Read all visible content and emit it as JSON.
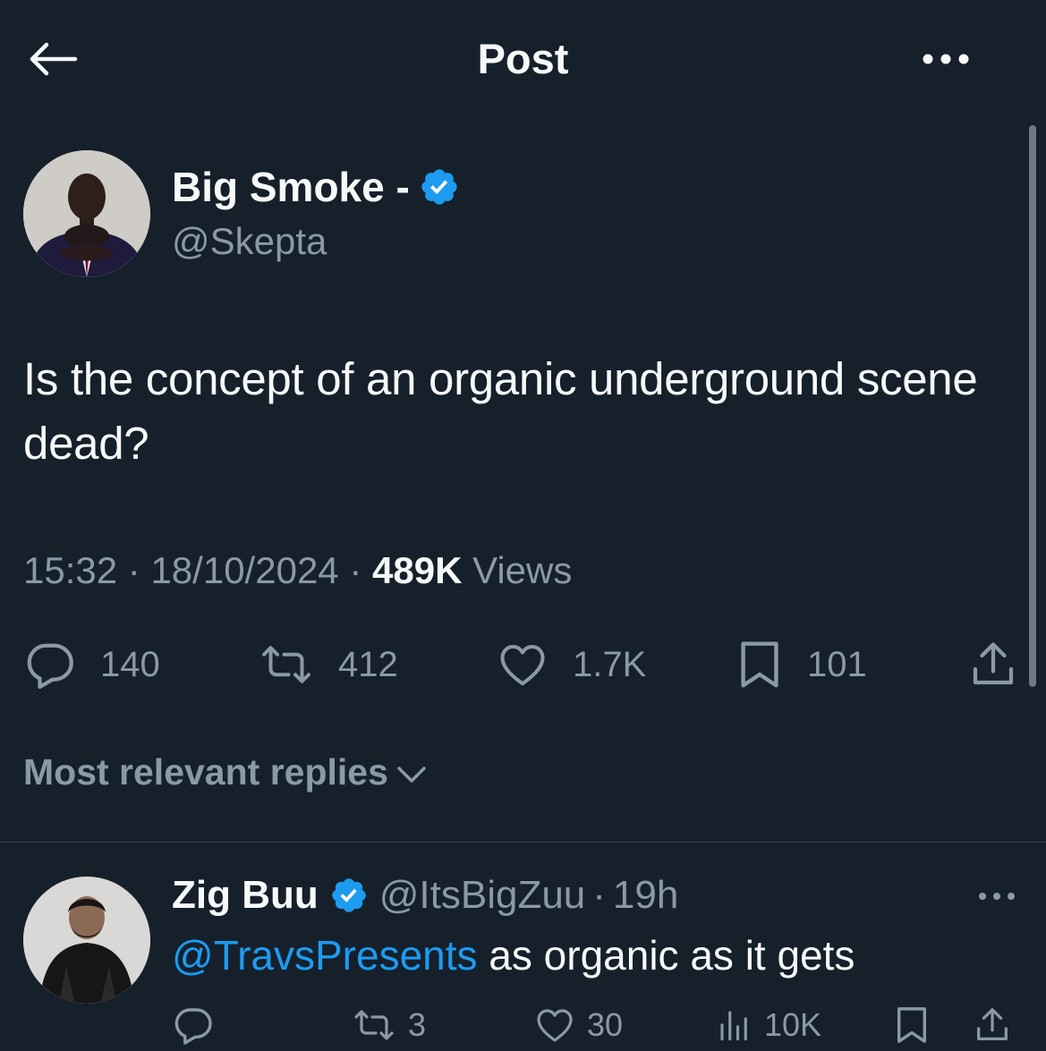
{
  "header": {
    "title": "Post"
  },
  "tweet": {
    "author_name": "Big Smoke -",
    "author_handle": "@Skepta",
    "text": "Is the concept of an organic underground scene dead?",
    "time": "15:32",
    "date": "18/10/2024",
    "separator": "·",
    "views_count": "489K",
    "views_label": "Views",
    "stats": {
      "replies": "140",
      "reposts": "412",
      "likes": "1.7K",
      "bookmarks": "101"
    }
  },
  "replies_sort": {
    "label": "Most relevant replies"
  },
  "reply": {
    "author_name": "Zig Buu",
    "author_handle": "@ItsBigZuu",
    "separator": "·",
    "time": "19h",
    "mention": "@TravsPresents",
    "text": " as organic as it gets",
    "stats": {
      "reposts": "3",
      "likes": "30",
      "views": "10K"
    }
  },
  "colors": {
    "background": "#15202b",
    "primary_text": "#f7f9f9",
    "secondary_text": "#8b98a5",
    "accent": "#1d9bf0",
    "verified_badge": "#1d9bf0",
    "divider": "#38444d"
  },
  "icons": {
    "back": "back-arrow-icon",
    "more": "more-horizontal-icon",
    "verified": "verified-badge-icon",
    "reply": "reply-bubble-icon",
    "repost": "repost-icon",
    "like": "heart-icon",
    "bookmark": "bookmark-icon",
    "share": "share-icon",
    "views": "bar-chart-icon",
    "chevron": "chevron-down-icon"
  }
}
